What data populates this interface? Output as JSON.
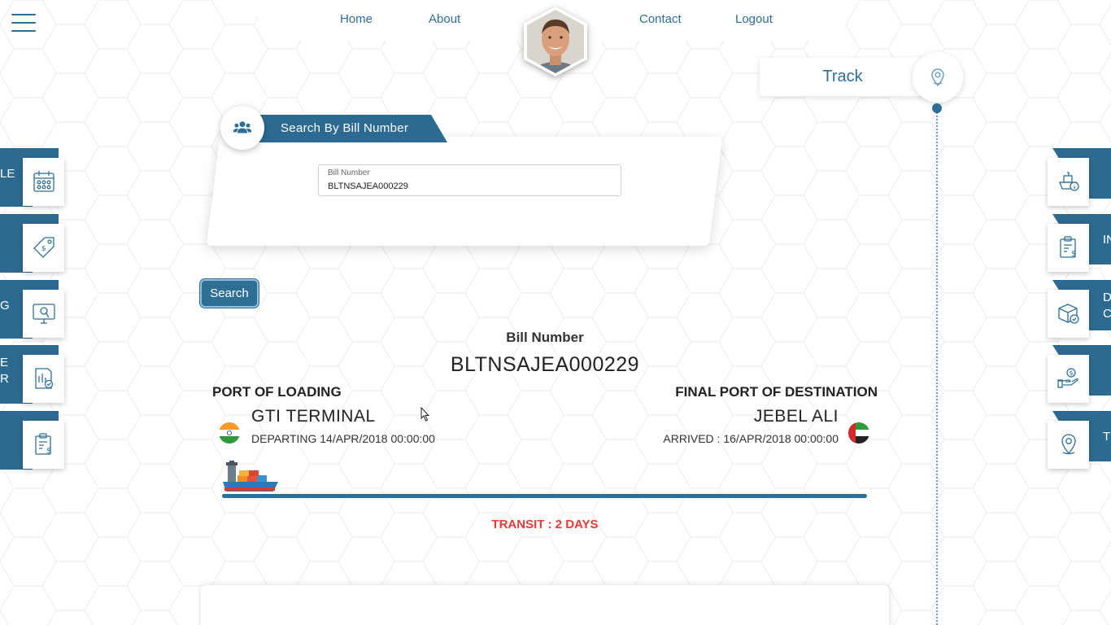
{
  "nav": {
    "items": [
      "Home",
      "About",
      "Contact",
      "Logout"
    ]
  },
  "track": {
    "label": "Track"
  },
  "search": {
    "banner_label": "Search By Bill Number",
    "field_label": "Bill Number",
    "field_value": "BLTNSAJEA000229",
    "button_label": "Search"
  },
  "result": {
    "bill_title": "Bill Number",
    "bill_value": "BLTNSAJEA000229",
    "loading_heading": "PORT OF LOADING",
    "loading_port": "GTI TERMINAL",
    "departing": "DEPARTING 14/APR/2018 00:00:00",
    "destination_heading": "FINAL PORT OF DESTINATION",
    "destination_port": "JEBEL ALI",
    "arrived": "ARRIVED : 16/APR/2018 00:00:00",
    "transit": "TRANSIT : 2 DAYS",
    "voyage_progress": 0
  },
  "left_tabs": [
    {
      "text": "LE",
      "icon": "calendar-icon"
    },
    {
      "text": "",
      "icon": "price-tag-icon"
    },
    {
      "text": "G",
      "icon": "monitor-touch-icon"
    },
    {
      "text": "E\nR",
      "icon": "report-check-icon"
    },
    {
      "text": "",
      "icon": "invoice-dollar-icon"
    }
  ],
  "right_tabs": [
    {
      "text": "",
      "icon": "ship-info-icon"
    },
    {
      "text": "IN",
      "icon": "clipboard-dollar-icon"
    },
    {
      "text": "D\nC",
      "icon": "package-check-icon"
    },
    {
      "text": "",
      "icon": "hand-coin-icon"
    },
    {
      "text": "T",
      "icon": "location-pin-icon"
    }
  ],
  "colors": {
    "primary": "#2f6f95",
    "ribbon": "#2d6a91",
    "transit": "#e53935"
  }
}
